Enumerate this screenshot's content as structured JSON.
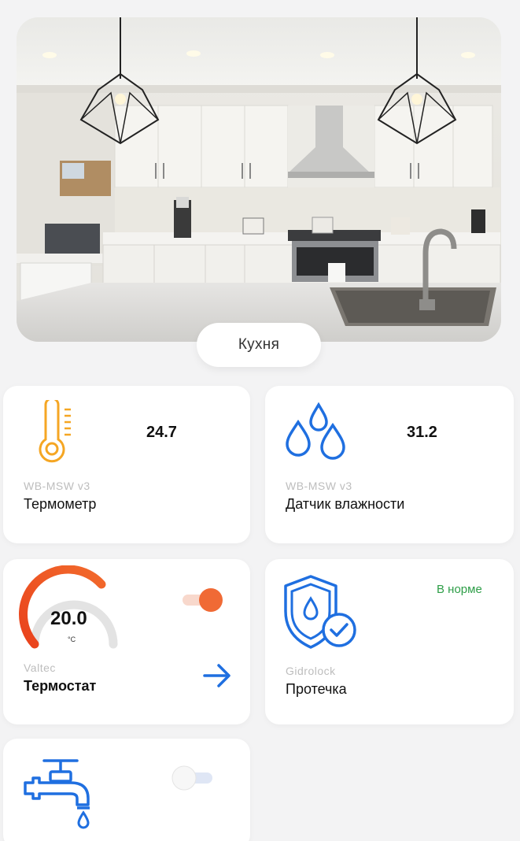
{
  "room": {
    "name": "Кухня"
  },
  "devices": [
    {
      "icon": "thermometer-icon",
      "model": "WB-MSW v3",
      "name": "Термометр",
      "value": "24.7"
    },
    {
      "icon": "humidity-drops-icon",
      "model": "WB-MSW v3",
      "name": "Датчик влажности",
      "value": "31.2"
    },
    {
      "icon": "thermostat-gauge",
      "model": "Valtec",
      "name": "Термостат",
      "value": "20.0",
      "unit": "°C",
      "toggle_on": true
    },
    {
      "icon": "shield-water-check-icon",
      "model": "Gidrolock",
      "name": "Протечка",
      "status": "В норме"
    },
    {
      "icon": "water-tap-icon",
      "toggle_on": false
    }
  ],
  "colors": {
    "accent_blue": "#1f6fe0",
    "accent_orange": "#f06a35",
    "thermo_orange": "#f5a623",
    "status_green": "#2e9e48"
  }
}
